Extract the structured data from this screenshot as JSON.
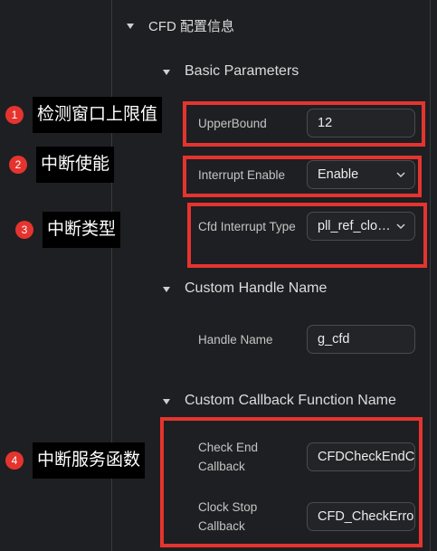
{
  "section": {
    "title": "CFD 配置信息"
  },
  "groups": {
    "basic": {
      "title": "Basic Parameters"
    },
    "handle": {
      "title": "Custom Handle Name"
    },
    "callback": {
      "title": "Custom Callback Function Name"
    }
  },
  "fields": {
    "upper_bound": {
      "label": "UpperBound",
      "value": "12"
    },
    "interrupt_enable": {
      "label": "Interrupt Enable",
      "value": "Enable"
    },
    "interrupt_type": {
      "label": "Cfd Interrupt Type",
      "value": "pll_ref_clock_fail"
    },
    "handle_name": {
      "label": "Handle Name",
      "value": "g_cfd"
    },
    "check_end_callback": {
      "label_line1": "Check End",
      "label_line2": "Callback",
      "value": "CFDCheckEndCallback"
    },
    "clock_stop_callback": {
      "label_line1": "Clock Stop",
      "label_line2": "Callback",
      "value": "CFD_CheckErrorCallback"
    }
  },
  "annotations": [
    {
      "num": "1",
      "text": "检测窗口上限值"
    },
    {
      "num": "2",
      "text": "中断使能"
    },
    {
      "num": "3",
      "text": "中断类型"
    },
    {
      "num": "4",
      "text": "中断服务函数"
    }
  ],
  "colors": {
    "background": "#1e1f22",
    "highlight": "#e5342f",
    "field_bg": "#232427",
    "annotation_bg": "#000000"
  },
  "icons": {
    "collapse": "caret-down-icon",
    "dropdown": "chevron-down-icon"
  }
}
